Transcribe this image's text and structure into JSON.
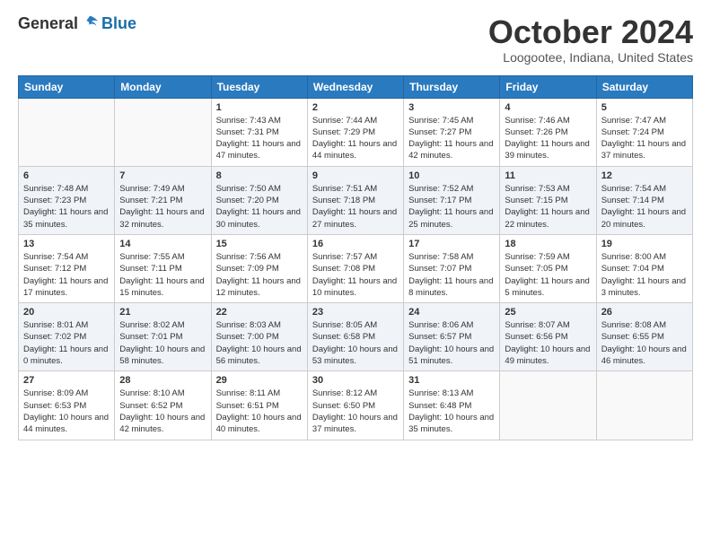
{
  "header": {
    "logo_general": "General",
    "logo_blue": "Blue",
    "month_title": "October 2024",
    "location": "Loogootee, Indiana, United States"
  },
  "weekdays": [
    "Sunday",
    "Monday",
    "Tuesday",
    "Wednesday",
    "Thursday",
    "Friday",
    "Saturday"
  ],
  "weeks": [
    [
      {
        "day": "",
        "info": ""
      },
      {
        "day": "",
        "info": ""
      },
      {
        "day": "1",
        "info": "Sunrise: 7:43 AM\nSunset: 7:31 PM\nDaylight: 11 hours and 47 minutes."
      },
      {
        "day": "2",
        "info": "Sunrise: 7:44 AM\nSunset: 7:29 PM\nDaylight: 11 hours and 44 minutes."
      },
      {
        "day": "3",
        "info": "Sunrise: 7:45 AM\nSunset: 7:27 PM\nDaylight: 11 hours and 42 minutes."
      },
      {
        "day": "4",
        "info": "Sunrise: 7:46 AM\nSunset: 7:26 PM\nDaylight: 11 hours and 39 minutes."
      },
      {
        "day": "5",
        "info": "Sunrise: 7:47 AM\nSunset: 7:24 PM\nDaylight: 11 hours and 37 minutes."
      }
    ],
    [
      {
        "day": "6",
        "info": "Sunrise: 7:48 AM\nSunset: 7:23 PM\nDaylight: 11 hours and 35 minutes."
      },
      {
        "day": "7",
        "info": "Sunrise: 7:49 AM\nSunset: 7:21 PM\nDaylight: 11 hours and 32 minutes."
      },
      {
        "day": "8",
        "info": "Sunrise: 7:50 AM\nSunset: 7:20 PM\nDaylight: 11 hours and 30 minutes."
      },
      {
        "day": "9",
        "info": "Sunrise: 7:51 AM\nSunset: 7:18 PM\nDaylight: 11 hours and 27 minutes."
      },
      {
        "day": "10",
        "info": "Sunrise: 7:52 AM\nSunset: 7:17 PM\nDaylight: 11 hours and 25 minutes."
      },
      {
        "day": "11",
        "info": "Sunrise: 7:53 AM\nSunset: 7:15 PM\nDaylight: 11 hours and 22 minutes."
      },
      {
        "day": "12",
        "info": "Sunrise: 7:54 AM\nSunset: 7:14 PM\nDaylight: 11 hours and 20 minutes."
      }
    ],
    [
      {
        "day": "13",
        "info": "Sunrise: 7:54 AM\nSunset: 7:12 PM\nDaylight: 11 hours and 17 minutes."
      },
      {
        "day": "14",
        "info": "Sunrise: 7:55 AM\nSunset: 7:11 PM\nDaylight: 11 hours and 15 minutes."
      },
      {
        "day": "15",
        "info": "Sunrise: 7:56 AM\nSunset: 7:09 PM\nDaylight: 11 hours and 12 minutes."
      },
      {
        "day": "16",
        "info": "Sunrise: 7:57 AM\nSunset: 7:08 PM\nDaylight: 11 hours and 10 minutes."
      },
      {
        "day": "17",
        "info": "Sunrise: 7:58 AM\nSunset: 7:07 PM\nDaylight: 11 hours and 8 minutes."
      },
      {
        "day": "18",
        "info": "Sunrise: 7:59 AM\nSunset: 7:05 PM\nDaylight: 11 hours and 5 minutes."
      },
      {
        "day": "19",
        "info": "Sunrise: 8:00 AM\nSunset: 7:04 PM\nDaylight: 11 hours and 3 minutes."
      }
    ],
    [
      {
        "day": "20",
        "info": "Sunrise: 8:01 AM\nSunset: 7:02 PM\nDaylight: 11 hours and 0 minutes."
      },
      {
        "day": "21",
        "info": "Sunrise: 8:02 AM\nSunset: 7:01 PM\nDaylight: 10 hours and 58 minutes."
      },
      {
        "day": "22",
        "info": "Sunrise: 8:03 AM\nSunset: 7:00 PM\nDaylight: 10 hours and 56 minutes."
      },
      {
        "day": "23",
        "info": "Sunrise: 8:05 AM\nSunset: 6:58 PM\nDaylight: 10 hours and 53 minutes."
      },
      {
        "day": "24",
        "info": "Sunrise: 8:06 AM\nSunset: 6:57 PM\nDaylight: 10 hours and 51 minutes."
      },
      {
        "day": "25",
        "info": "Sunrise: 8:07 AM\nSunset: 6:56 PM\nDaylight: 10 hours and 49 minutes."
      },
      {
        "day": "26",
        "info": "Sunrise: 8:08 AM\nSunset: 6:55 PM\nDaylight: 10 hours and 46 minutes."
      }
    ],
    [
      {
        "day": "27",
        "info": "Sunrise: 8:09 AM\nSunset: 6:53 PM\nDaylight: 10 hours and 44 minutes."
      },
      {
        "day": "28",
        "info": "Sunrise: 8:10 AM\nSunset: 6:52 PM\nDaylight: 10 hours and 42 minutes."
      },
      {
        "day": "29",
        "info": "Sunrise: 8:11 AM\nSunset: 6:51 PM\nDaylight: 10 hours and 40 minutes."
      },
      {
        "day": "30",
        "info": "Sunrise: 8:12 AM\nSunset: 6:50 PM\nDaylight: 10 hours and 37 minutes."
      },
      {
        "day": "31",
        "info": "Sunrise: 8:13 AM\nSunset: 6:48 PM\nDaylight: 10 hours and 35 minutes."
      },
      {
        "day": "",
        "info": ""
      },
      {
        "day": "",
        "info": ""
      }
    ]
  ]
}
